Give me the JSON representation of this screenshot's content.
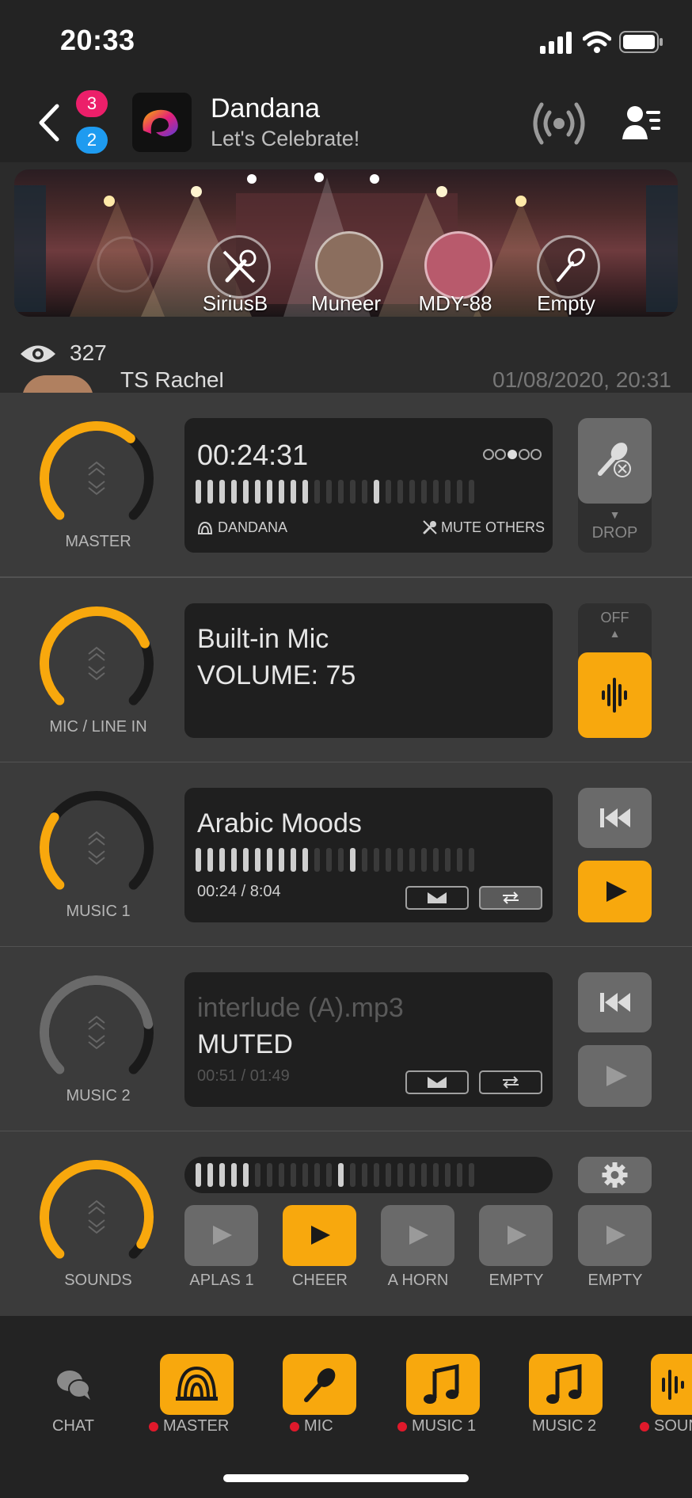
{
  "status_bar": {
    "time": "20:33"
  },
  "header": {
    "badge_top": "3",
    "badge_bottom": "2",
    "title": "Dandana",
    "subtitle": "Let's Celebrate!"
  },
  "stage": {
    "seats": [
      {
        "label": "SiriusB"
      },
      {
        "label": "Muneer"
      },
      {
        "label": "MDY-88"
      },
      {
        "label": "Empty"
      }
    ],
    "viewers": "327"
  },
  "chat_peek": {
    "name": "TS Rachel",
    "timestamp": "01/08/2020, 20:31"
  },
  "channels": {
    "master": {
      "label": "MASTER",
      "time": "00:24:31",
      "level": 0.65,
      "source": "DANDANA",
      "mute_others": "MUTE OTHERS",
      "drop": "DROP"
    },
    "mic": {
      "label": "MIC / LINE IN",
      "line1": "Built-in Mic",
      "line2": "VOLUME: 75",
      "level": 0.75,
      "toggle_off": "OFF"
    },
    "music1": {
      "label": "MUSIC 1",
      "title": "Arabic Moods",
      "position": "00:24 / 8:04",
      "level": 0.3
    },
    "music2": {
      "label": "MUSIC 2",
      "title": "interlude (A).mp3",
      "status": "MUTED",
      "position": "00:51 / 01:49",
      "level": 0.8
    },
    "sounds": {
      "label": "SOUNDS",
      "level": 0.95,
      "pads": [
        "APLAS 1",
        "CHEER",
        "A HORN",
        "EMPTY",
        "EMPTY"
      ]
    }
  },
  "bottom_nav": {
    "items": [
      "CHAT",
      "MASTER",
      "MIC",
      "MUSIC 1",
      "MUSIC 2",
      "SOUN"
    ]
  },
  "colors": {
    "accent": "#f8a80d",
    "panel": "#1f1f1f",
    "row": "#3b3b3b",
    "record_dot": "#e0192b"
  }
}
